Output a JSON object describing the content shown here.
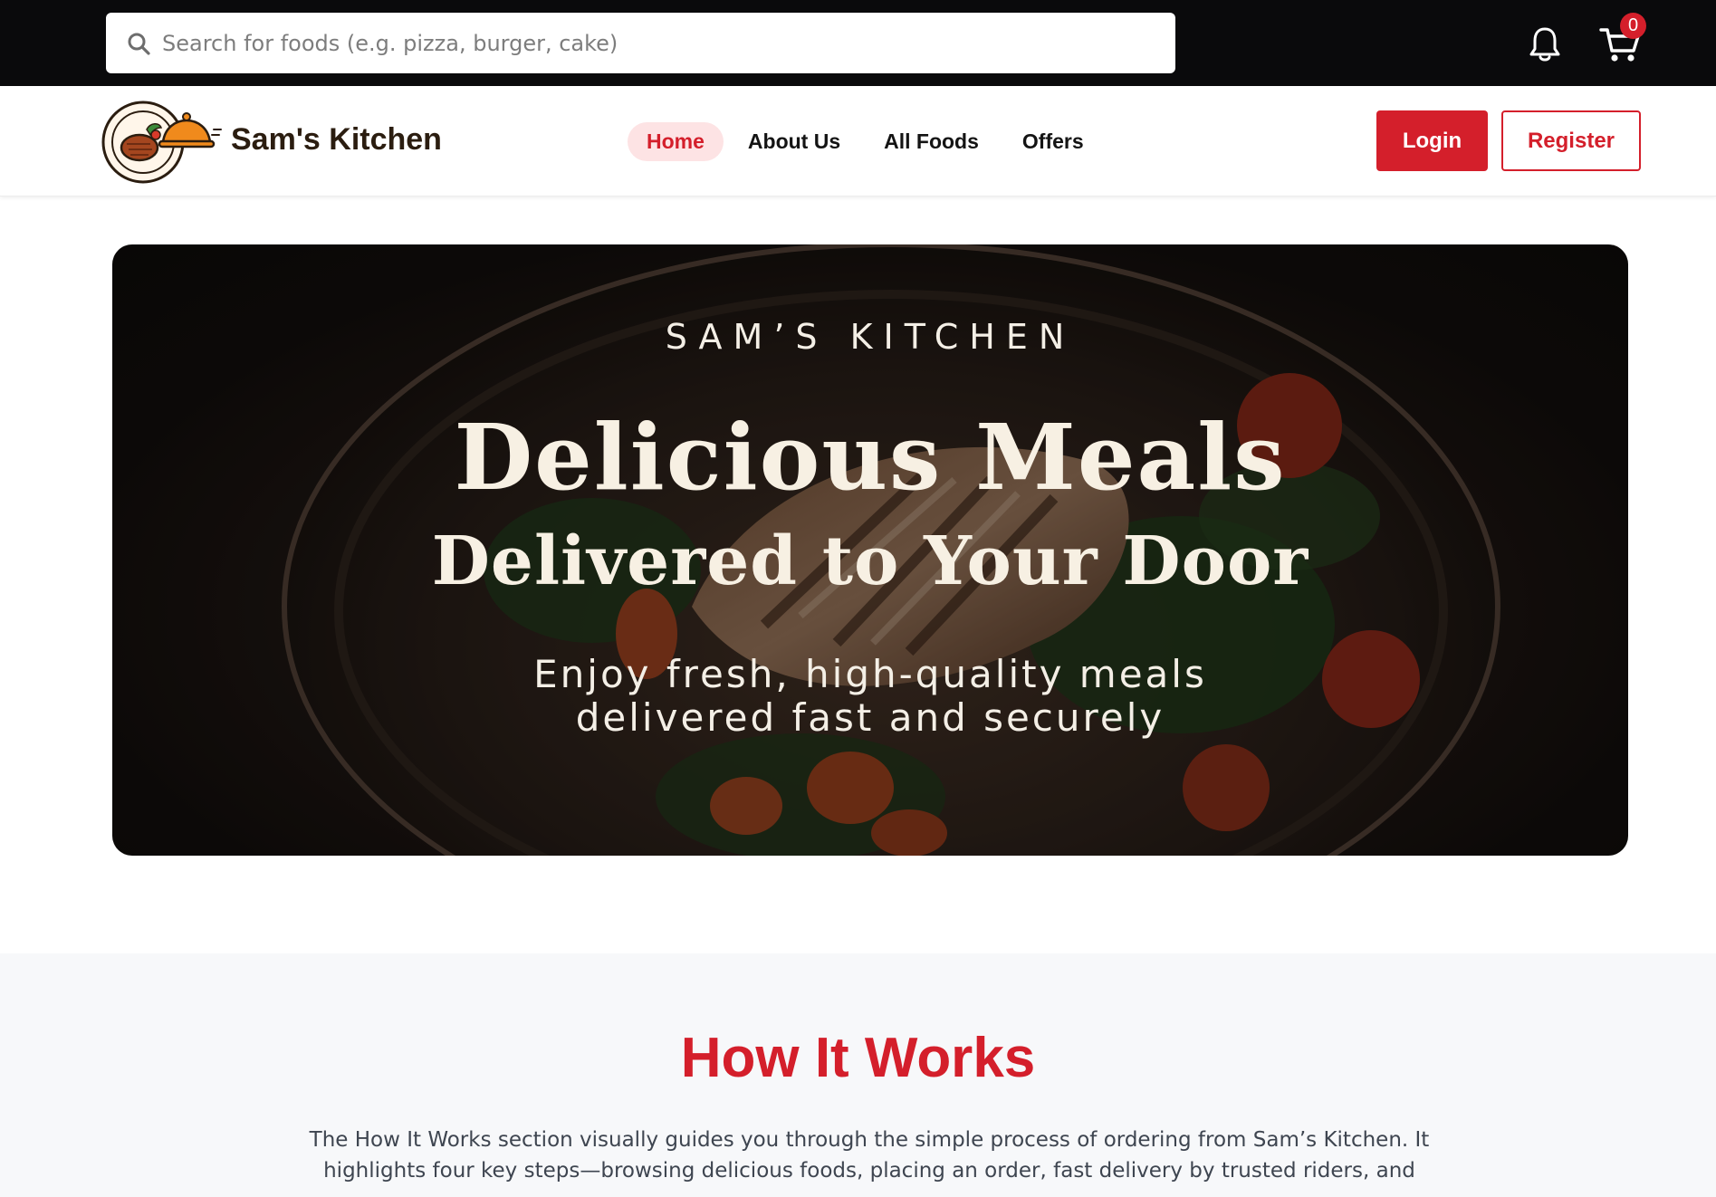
{
  "search": {
    "placeholder": "Search for foods (e.g. pizza, burger, cake)",
    "icon": "search-icon"
  },
  "header_icons": {
    "notifications_icon": "bell-icon",
    "cart_icon": "cart-icon",
    "cart_count": "0"
  },
  "brand": {
    "name": "Sam's Kitchen",
    "logo_icon": "dish-cloche-logo"
  },
  "nav": {
    "items": [
      {
        "label": "Home",
        "active": true
      },
      {
        "label": "About Us",
        "active": false
      },
      {
        "label": "All Foods",
        "active": false
      },
      {
        "label": "Offers",
        "active": false
      }
    ]
  },
  "auth": {
    "login_label": "Login",
    "register_label": "Register"
  },
  "hero": {
    "kicker": "SAM’S KITCHEN",
    "title_line_1": "Delicious Meals",
    "title_line_2": "Delivered to Your Door",
    "subtitle_line_1": "Enjoy fresh, high-quality meals",
    "subtitle_line_2": "delivered fast and securely"
  },
  "how_it_works": {
    "title": "How It Works",
    "description": "The How It Works section visually guides you through the simple process of ordering from Sam’s Kitchen. It highlights four key steps—browsing delicious foods, placing an order, fast delivery by trusted riders, and"
  },
  "colors": {
    "accent": "#d41f2b",
    "topbar": "#0a0a0c",
    "nav_active_bg": "#fde3e4",
    "brand_text": "#2b1d10"
  }
}
